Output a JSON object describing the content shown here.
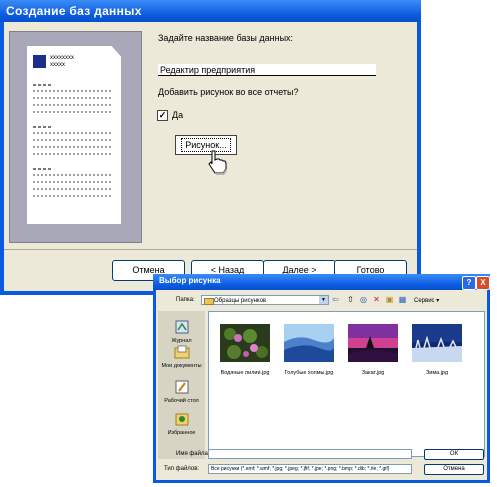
{
  "wizard": {
    "title": "Создание баз данных",
    "thumb_header_1": "xxxxxxxx",
    "thumb_header_2": "xxxxx",
    "name_prompt": "Задайте название базы данных:",
    "name_value": "Редактир предприятия",
    "picture_prompt": "Добавить рисунок во все отчеты?",
    "checkbox_checked": true,
    "checkbox_label": "Да",
    "picture_button": "Рисунок...",
    "buttons": {
      "cancel": "Отмена",
      "back": "< Назад",
      "next": "Далее >",
      "finish": "Готово"
    }
  },
  "dialog": {
    "title": "Выбор рисунка",
    "help_button": "?",
    "close_button": "X",
    "look_in_label": "Папка:",
    "look_in_value": "Образцы рисунков",
    "tools_label": "Сервис",
    "places": [
      {
        "label": "Журнал",
        "icon": "history-icon"
      },
      {
        "label": "Мои документы",
        "icon": "my-documents-icon"
      },
      {
        "label": "Рабочий стол",
        "icon": "desktop-icon"
      },
      {
        "label": "Избранное",
        "icon": "favorites-icon"
      }
    ],
    "files": [
      {
        "name": "Водяные лилии.jpg"
      },
      {
        "name": "Голубые холмы.jpg"
      },
      {
        "name": "Закат.jpg"
      },
      {
        "name": "Зима.jpg"
      }
    ],
    "file_name_label": "Имя файла:",
    "file_name_value": "",
    "file_type_label": "Тип файлов:",
    "file_type_value": "Все рисунки (*.emf; *.wmf; *.jpg; *.jpeg; *.jfif; *.jpe; *.png; *.bmp; *.dib; *.rle; *.gif)",
    "ok_button": "ОК",
    "cancel_button": "Отмена"
  }
}
